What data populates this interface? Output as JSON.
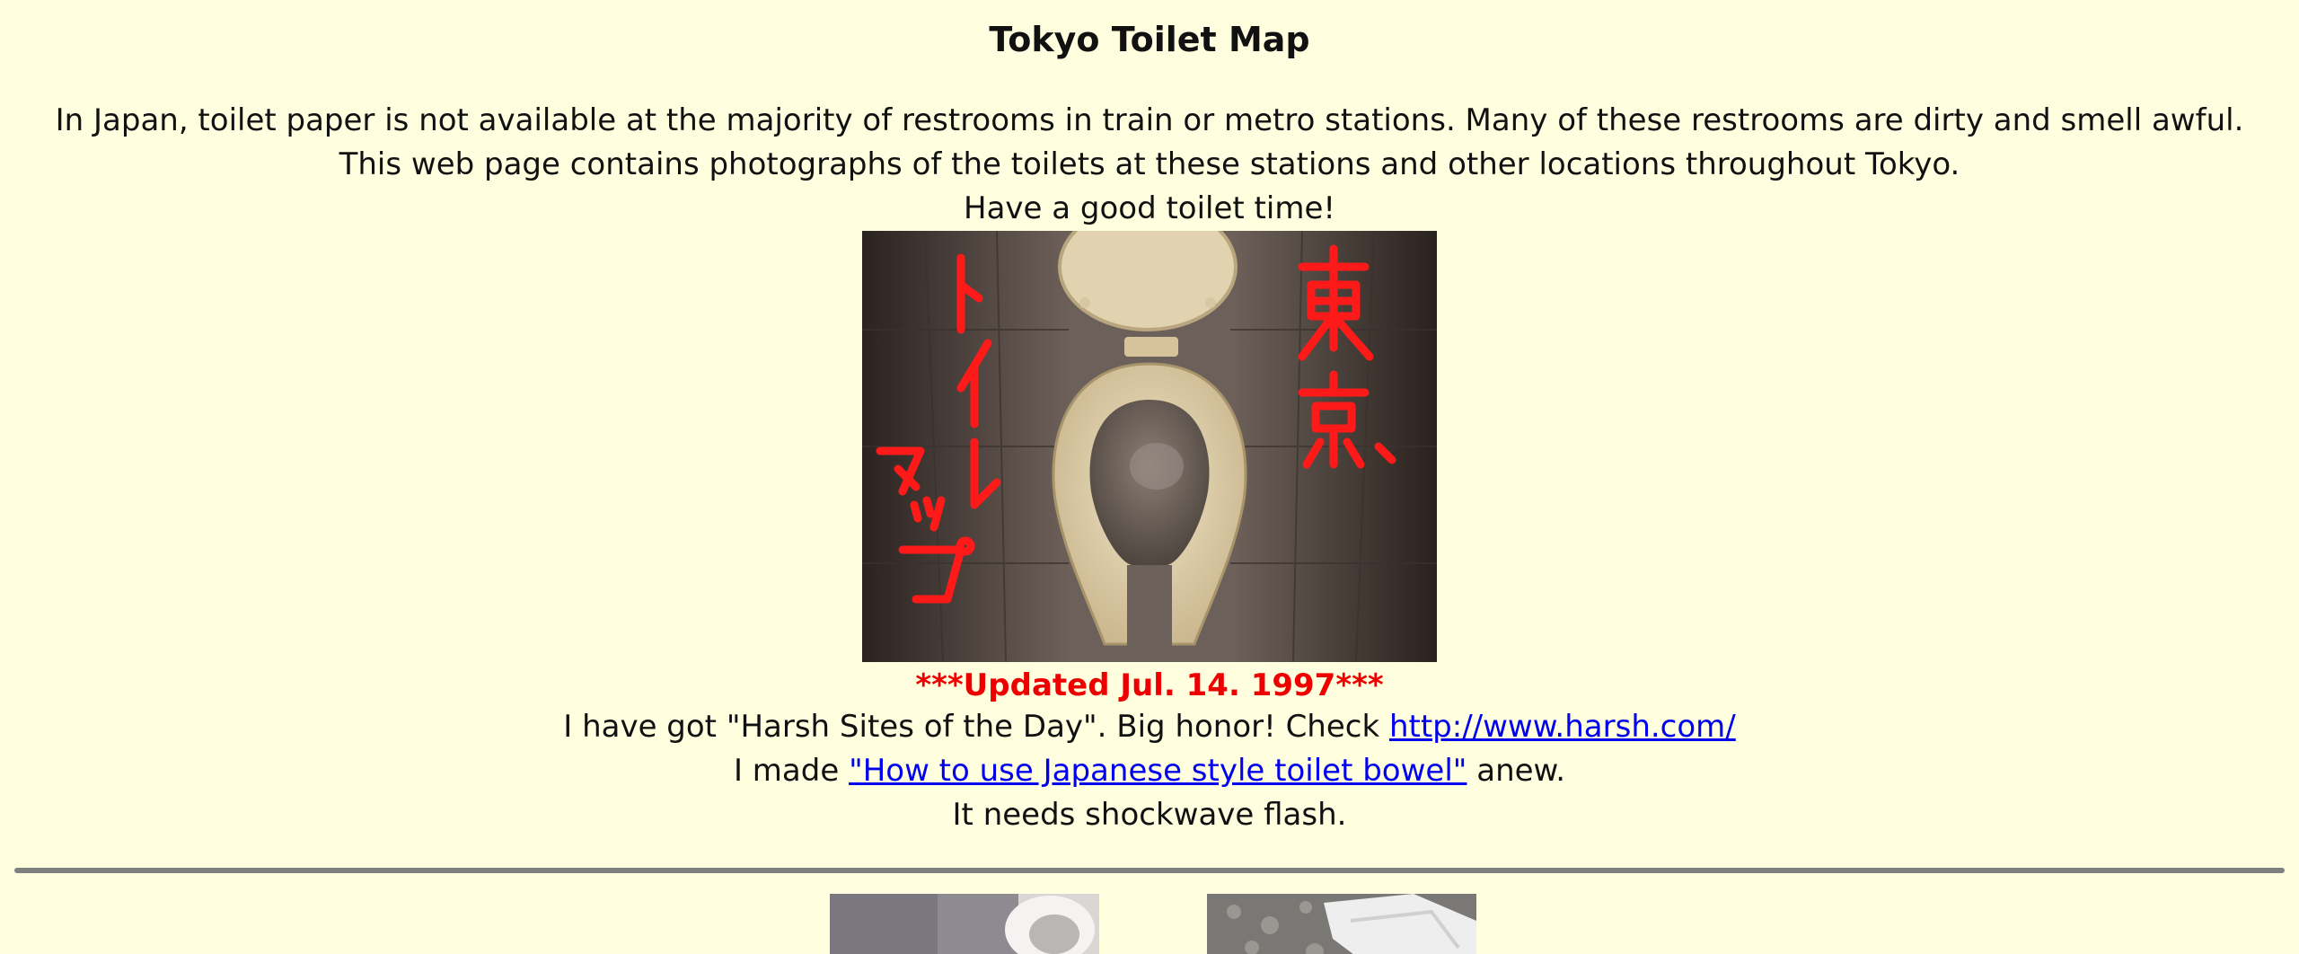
{
  "page": {
    "title": "Tokyo Toilet Map",
    "intro_lines": [
      "In Japan, toilet paper is not available at the majority of restrooms in train or metro stations. Many of these restrooms are dirty and smell awful.",
      "This web page contains photographs of the toilets at these stations and other locations throughout Tokyo.",
      "Have a good toilet time!"
    ],
    "hero_overlay": {
      "left_text": "トイレマップ",
      "right_text": "東京"
    },
    "updated": "***Updated Jul. 14. 1997***",
    "award": {
      "text": "I have got \"Harsh Sites of the Day\". Big honor! Check ",
      "link_text": "http://www.harsh.com/"
    },
    "howto": {
      "prefix": "I made ",
      "link_text": "\"How to use Japanese style toilet bowel\"",
      "suffix": " anew."
    },
    "flash_note": "It needs shockwave flash."
  },
  "colors": {
    "background": "#ffffe0",
    "updated_red": "#ee0000",
    "link_blue": "#0000ee",
    "rule_gray": "#808080"
  }
}
